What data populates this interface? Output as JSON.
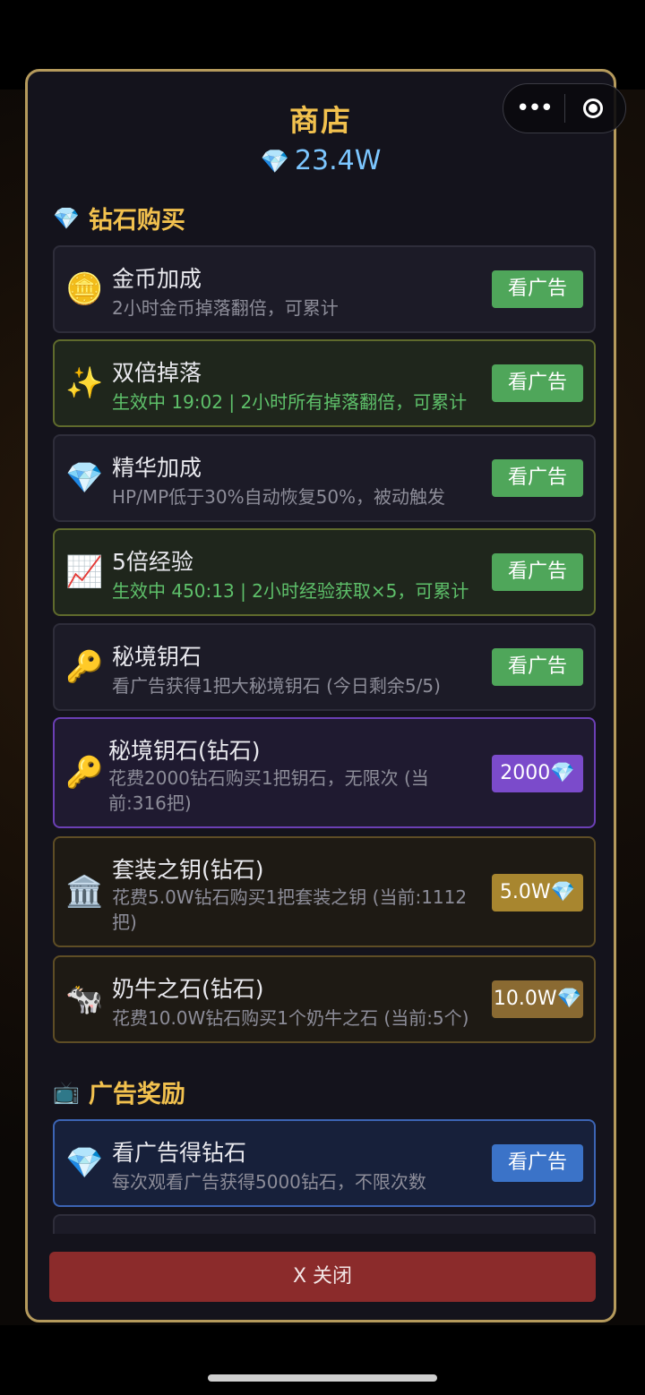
{
  "header": {
    "title": "商店",
    "balance": "23.4W",
    "balance_icon": "gem-icon"
  },
  "capsule": {
    "more_icon": "more-dots-icon",
    "close_icon": "target-icon"
  },
  "sections": {
    "diamond_purchase": {
      "title": "钻石购买",
      "icon": "gem-icon"
    },
    "ad_rewards": {
      "title": "广告奖励",
      "icon": "tv-icon"
    }
  },
  "items": [
    {
      "name": "金币加成",
      "desc": "2小时金币掉落翻倍，可累计",
      "button": "看广告",
      "icon": "coin-icon"
    },
    {
      "name": "双倍掉落",
      "desc": "生效中 19:02 | 2小时所有掉落翻倍，可累计",
      "button": "看广告",
      "icon": "sparkles-icon"
    },
    {
      "name": "精华加成",
      "desc": "HP/MP低于30%自动恢复50%，被动触发",
      "button": "看广告",
      "icon": "gem-icon"
    },
    {
      "name": "5倍经验",
      "desc": "生效中 450:13 | 2小时经验获取×5，可累计",
      "button": "看广告",
      "icon": "chart-icon"
    },
    {
      "name": "秘境钥石",
      "desc": "看广告获得1把大秘境钥石 (今日剩余5/5)",
      "button": "看广告",
      "icon": "key-icon"
    },
    {
      "name": "秘境钥石(钻石)",
      "desc_line1": "花费2000钻石购买1把钥石，无限次 (当",
      "desc_line2": "前:316把)",
      "button": "2000💎",
      "icon": "key-icon"
    },
    {
      "name": "套装之钥(钻石)",
      "desc_line1": "花费5.0W钻石购买1把套装之钥 (当前:1112",
      "desc_line2": "把)",
      "button": "5.0W💎",
      "icon": "bank-icon"
    },
    {
      "name": "奶牛之石(钻石)",
      "desc": "花费10.0W钻石购买1个奶牛之石 (当前:5个)",
      "button": "10.0W💎",
      "icon": "cow-icon"
    }
  ],
  "ad_items": [
    {
      "name": "看广告得钻石",
      "desc": "每次观看广告获得5000钻石，不限次数",
      "button": "看广告",
      "icon": "gem-icon"
    }
  ],
  "footer": {
    "close_label": "X  关闭"
  },
  "colors": {
    "accent": "#f2c14e",
    "frame": "#b59a5c",
    "green_button": "#4fa65a",
    "close_button": "#8b2b2b"
  }
}
